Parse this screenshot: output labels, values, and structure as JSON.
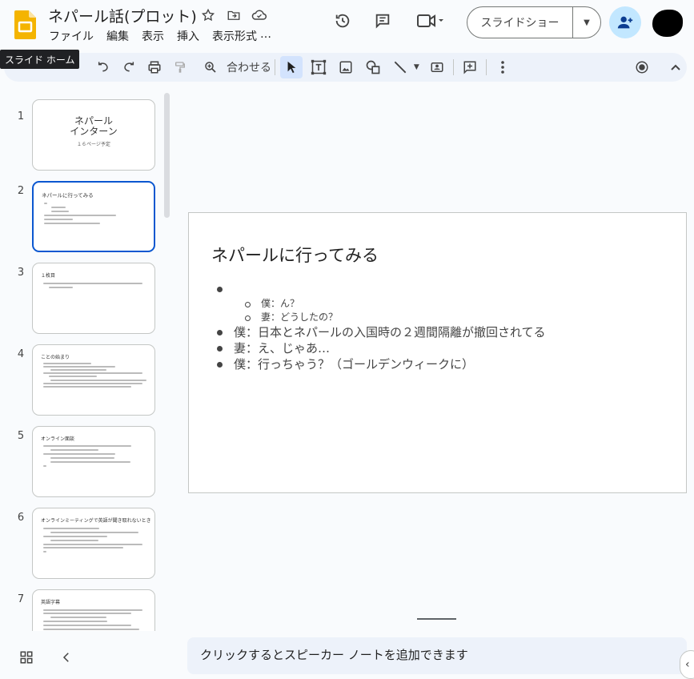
{
  "app": {
    "title": "ネパール話(プロット)"
  },
  "menu": [
    "ファイル",
    "編集",
    "表示",
    "挿入",
    "表示形式",
    "…"
  ],
  "header": {
    "slideshow_label": "スライドショー"
  },
  "toolbar": {
    "zoom_label": "合わせる",
    "tooltip": "スライド ホーム"
  },
  "filmstrip": {
    "slides": [
      {
        "num": "1",
        "title": "ネパール\nインターン",
        "subtitle": "１６ページ予定"
      },
      {
        "num": "2",
        "title": "ネパールに行ってみる"
      },
      {
        "num": "3",
        "title": "１枚目"
      },
      {
        "num": "4",
        "title": "ことの始まり"
      },
      {
        "num": "5",
        "title": "オンライン面談"
      },
      {
        "num": "6",
        "title": "オンラインミーティングで英語が聞き取れないとき"
      },
      {
        "num": "7",
        "title": "英語字幕"
      }
    ]
  },
  "slide": {
    "title": "ネパールに行ってみる",
    "bullets": [
      {
        "level": 1,
        "text": ""
      },
      {
        "level": 2,
        "text": "僕：ん？"
      },
      {
        "level": 2,
        "text": "妻：どうしたの？"
      },
      {
        "level": 1,
        "text": "僕：日本とネパールの入国時の２週間隔離が撤回されてる"
      },
      {
        "level": 1,
        "text": "妻：え、じゃあ…"
      },
      {
        "level": 1,
        "text": "僕：行っちゃう？（ゴールデンウィークに）"
      }
    ]
  },
  "notes": {
    "placeholder": "クリックするとスピーカー ノートを追加できます"
  }
}
